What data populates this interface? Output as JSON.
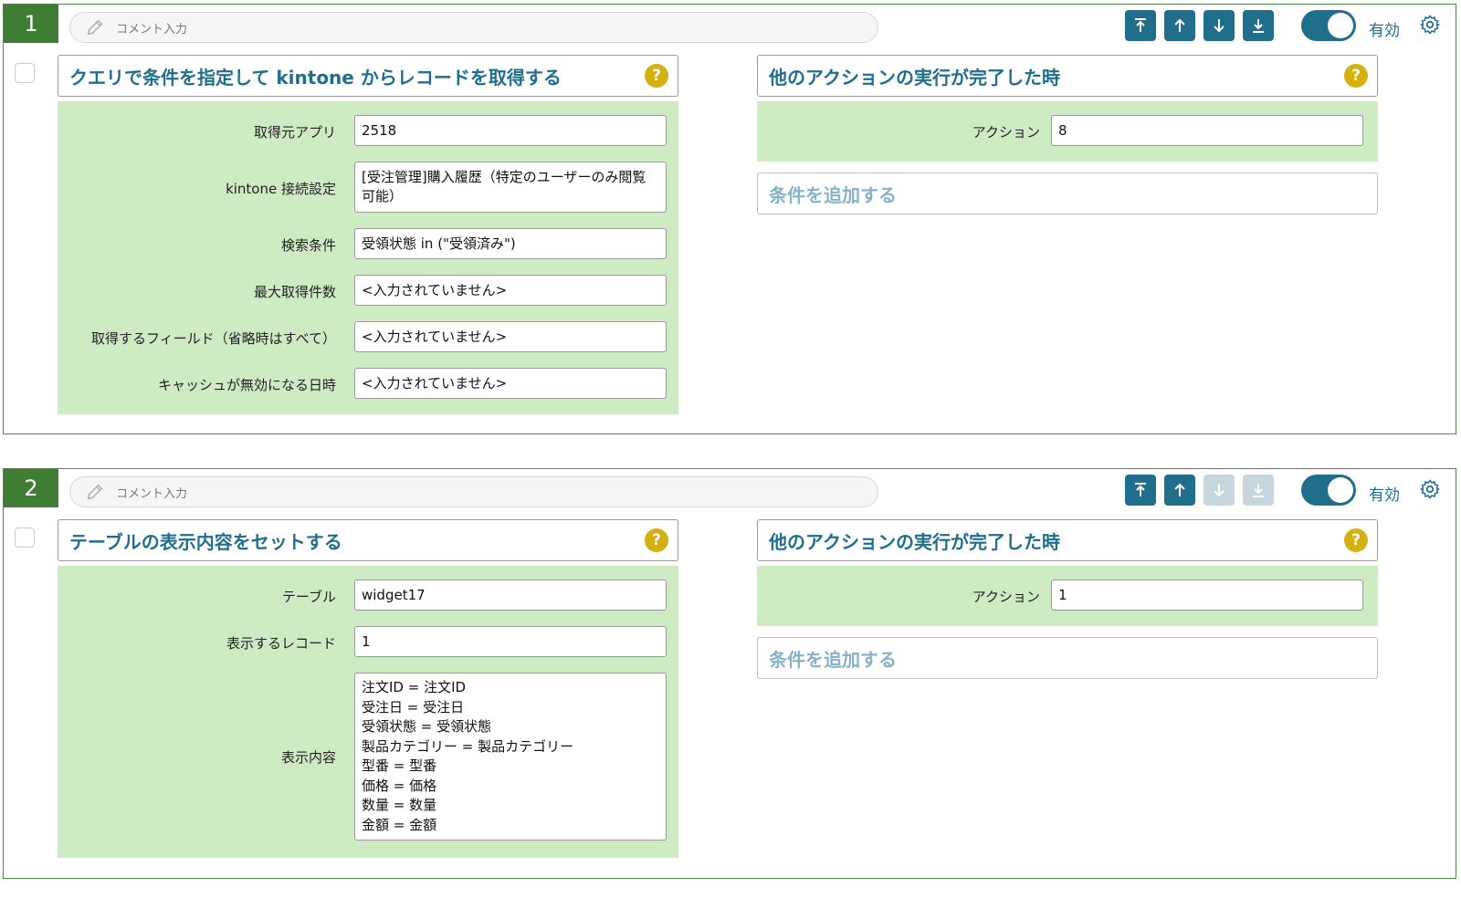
{
  "cards": [
    {
      "number": "1",
      "comment_placeholder": "コメント入力",
      "status_label": "有効",
      "action": {
        "title": "クエリで条件を指定して kintone からレコードを取得する",
        "fields": [
          {
            "label": "取得元アプリ",
            "value": "2518"
          },
          {
            "label": "kintone 接続設定",
            "value": "[受注管理]購入履歴（特定のユーザーのみ閲覧可能）"
          },
          {
            "label": "検索条件",
            "value": "受領状態 in (\"受領済み\")"
          },
          {
            "label": "最大取得件数",
            "value": "<入力されていません>"
          },
          {
            "label": "取得するフィールド（省略時はすべて）",
            "value": "<入力されていません>"
          },
          {
            "label": "キャッシュが無効になる日時",
            "value": "<入力されていません>"
          }
        ]
      },
      "trigger": {
        "title": "他のアクションの実行が完了した時",
        "field_label": "アクション",
        "field_value": "8",
        "add_condition_label": "条件を追加する"
      },
      "move_down_enabled": true
    },
    {
      "number": "2",
      "comment_placeholder": "コメント入力",
      "status_label": "有効",
      "action": {
        "title": "テーブルの表示内容をセットする",
        "fields": [
          {
            "label": "テーブル",
            "value": "widget17"
          },
          {
            "label": "表示するレコード",
            "value": "1"
          },
          {
            "label": "表示内容",
            "value": "注文ID = 注文ID\n受注日 = 受注日\n受領状態 = 受領状態\n製品カテゴリー = 製品カテゴリー\n型番 = 型番\n価格 = 価格\n数量 = 数量\n金額 = 金額"
          }
        ]
      },
      "trigger": {
        "title": "他のアクションの実行が完了した時",
        "field_label": "アクション",
        "field_value": "1",
        "add_condition_label": "条件を追加する"
      },
      "move_down_enabled": false
    }
  ],
  "icons": {
    "comment": "pencil-icon",
    "move_top": "arrow-to-top-icon",
    "move_up": "arrow-up-icon",
    "move_down": "arrow-down-icon",
    "move_bottom": "arrow-to-bottom-icon",
    "settings": "gear-icon",
    "help": "help-icon"
  },
  "colors": {
    "accent": "#1f6e8c",
    "card_number_bg": "#3f7d35",
    "field_area_bg": "#cfebc3",
    "help_badge": "#d4b010"
  }
}
